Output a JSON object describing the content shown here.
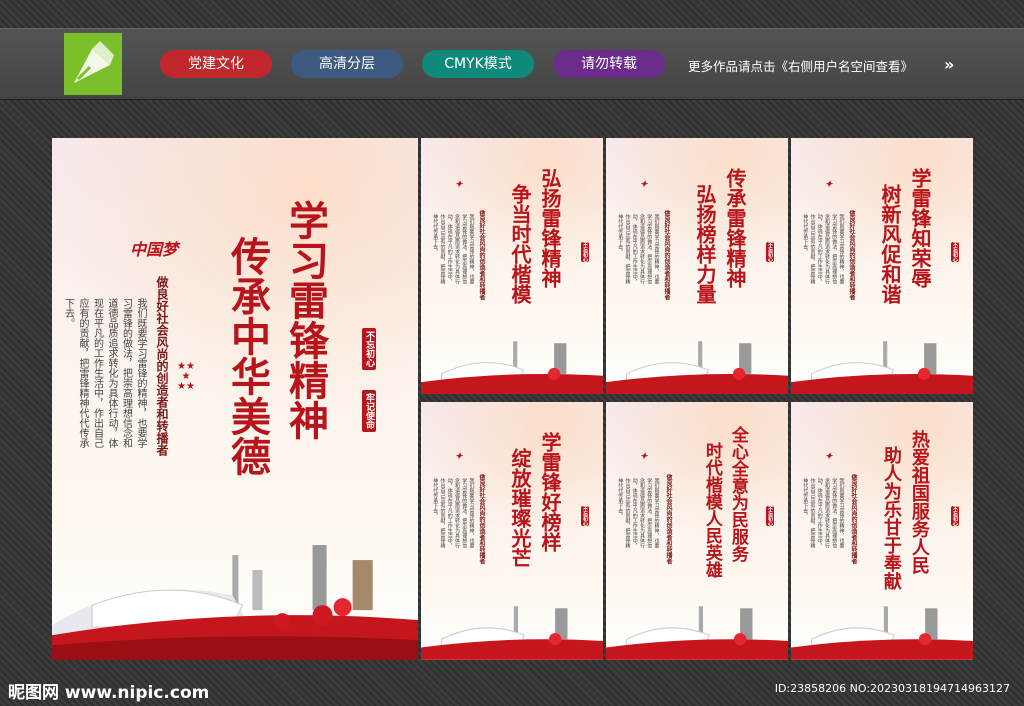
{
  "topbar": {
    "tags": [
      "党建文化",
      "高清分层",
      "CMYK模式",
      "请勿转载"
    ],
    "more_text": "更多作品请点击《右侧用户名空间查看》",
    "arrow": "»"
  },
  "main_poster": {
    "title1": "学习雷锋精神",
    "title2": "传承中华美德",
    "subtitle": "做良好社会风尚的创造者和转播者",
    "body": "我们既要学习雷锋的精神，也要学习雷锋的做法，把崇高理想信念和道德品质追求转化为具体行动，体现在平凡的工作生活中，作出自己应有的贡献，把雷锋精神代代传承下去。",
    "stamp1": "不忘初心",
    "stamp2": "牢记使命",
    "logo_text": "中国梦"
  },
  "posters": [
    {
      "t1": "弘扬雷锋精神",
      "t2": "争当时代楷模"
    },
    {
      "t1": "传承雷锋精神",
      "t2": "弘扬榜样力量"
    },
    {
      "t1": "学雷锋知荣辱",
      "t2": "树新风促和谐"
    },
    {
      "t1": "学雷锋好榜样",
      "t2": "绽放璀璨光芒"
    },
    {
      "t1": "全心全意为民服务",
      "t2": "时代楷模人民英雄"
    },
    {
      "t1": "热爱祖国服务人民",
      "t2": "助人为乐甘于奉献"
    }
  ],
  "footer": {
    "site": "昵图网 www.nipic.com",
    "id": "ID:23858206 NO:20230318194714963127"
  },
  "colors": {
    "primary_red": "#b7141b",
    "logo_green": "#7bbf2a"
  }
}
